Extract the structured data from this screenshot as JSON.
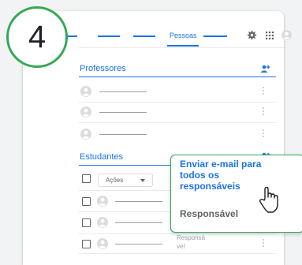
{
  "step_badge": {
    "number": "4"
  },
  "nav": {
    "active_tab": "Pessoas"
  },
  "icons": {
    "settings": "gear-icon",
    "apps": "apps-grid-icon",
    "account": "account-avatar-icon",
    "add_teacher": "add-person-icon",
    "add_student": "add-person-icon",
    "menu": "more-vert-icon",
    "pointer": "hand-pointer-icon"
  },
  "teachers": {
    "title": "Professores",
    "rows": [
      {},
      {},
      {}
    ]
  },
  "students": {
    "title": "Estudantes",
    "actions_label": "Ações",
    "rows": [
      {
        "hidden_label": ""
      },
      {
        "hidden_label": ""
      },
      {
        "hidden_label": "Responsá vel"
      }
    ]
  },
  "popup": {
    "items": [
      {
        "label": "Enviar e-mail para todos os responsáveis"
      },
      {
        "label": "Responsável"
      }
    ]
  },
  "colors": {
    "accent": "#1a73e8",
    "highlight_border": "#34a853",
    "placeholder": "#bdc1c6"
  }
}
